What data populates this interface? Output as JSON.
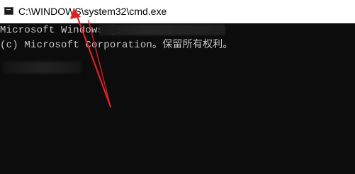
{
  "window": {
    "title": "C:\\WINDOWS\\system32\\cmd.exe",
    "icon": "cmd-icon"
  },
  "console": {
    "lines": [
      "Microsoft Windows [",
      "(c) Microsoft Corporation。保留所有权利。"
    ]
  },
  "annotation": {
    "type": "red-arrow",
    "color": "#e02020",
    "points_to": "window title"
  }
}
